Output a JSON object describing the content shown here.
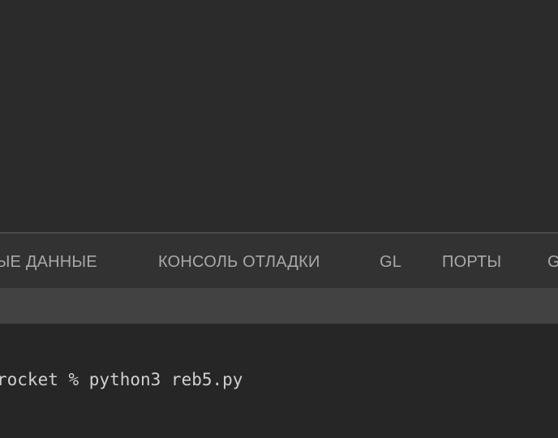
{
  "panel": {
    "tabs": [
      {
        "label": "НЫЕ ДАННЫЕ"
      },
      {
        "label": "КОНСОЛЬ ОТЛАДКИ"
      },
      {
        "label": "GL"
      },
      {
        "label": "ПОРТЫ"
      },
      {
        "label": "G"
      }
    ]
  },
  "terminal": {
    "line": "rocket % python3 reb5.py"
  }
}
